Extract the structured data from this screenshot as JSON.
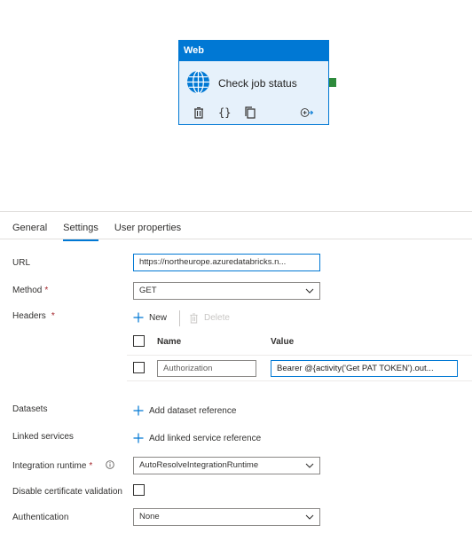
{
  "card": {
    "type": "Web",
    "title": "Check job status",
    "icons": [
      "globe-icon",
      "delete-icon",
      "code-braces-icon",
      "copy-icon",
      "add-output-icon"
    ],
    "braces": "{}",
    "colors": {
      "accent": "#0078d4",
      "card_bg": "#e6f1fb",
      "connector": "#2e8b3c"
    }
  },
  "tabs": [
    {
      "label": "General"
    },
    {
      "label": "Settings",
      "active": true
    },
    {
      "label": "User properties"
    }
  ],
  "form": {
    "url": {
      "label": "URL",
      "value": "https://northeurope.azuredatabricks.n..."
    },
    "method": {
      "label": "Method",
      "required": "*",
      "value": "GET"
    },
    "headers": {
      "label": "Headers",
      "required": "*",
      "new_label": "New",
      "delete_label": "Delete",
      "col_name": "Name",
      "col_value": "Value",
      "rows": [
        {
          "name": "Authorization",
          "value": "Bearer @{activity('Get PAT TOKEN').out..."
        }
      ]
    },
    "datasets": {
      "label": "Datasets",
      "add_label": "Add dataset reference"
    },
    "linked_services": {
      "label": "Linked services",
      "add_label": "Add linked service reference"
    },
    "integration_runtime": {
      "label": "Integration runtime",
      "required": "*",
      "value": "AutoResolveIntegrationRuntime"
    },
    "disable_cert": {
      "label": "Disable certificate validation"
    },
    "authentication": {
      "label": "Authentication",
      "value": "None"
    }
  }
}
